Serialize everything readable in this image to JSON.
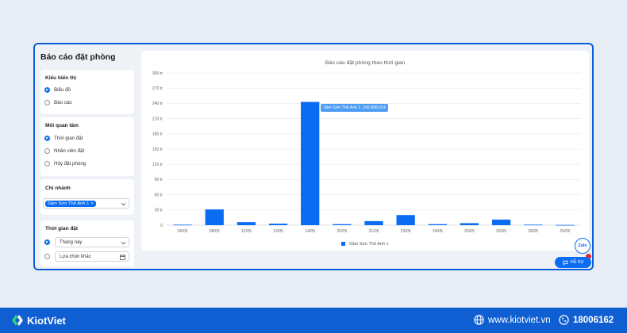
{
  "page_title": "Báo cáo đặt phòng",
  "display_type": {
    "title": "Kiểu hiển thị",
    "options": [
      {
        "label": "Biểu đồ",
        "selected": true
      },
      {
        "label": "Báo cáo",
        "selected": false
      }
    ]
  },
  "concern": {
    "title": "Mối quan tâm",
    "options": [
      {
        "label": "Thời gian đặt",
        "selected": true
      },
      {
        "label": "Nhân viên đặt",
        "selected": false
      },
      {
        "label": "Hủy đặt phòng",
        "selected": false
      }
    ]
  },
  "branch": {
    "title": "Chi nhánh",
    "selected_tag": "Sầm Sơn Thế Anh 1",
    "remove_glyph": "×"
  },
  "booking_time": {
    "title": "Thời gian đặt",
    "options": [
      {
        "label": "Tháng này",
        "selected": true,
        "control": "select"
      },
      {
        "label": "Lựa chọn khác",
        "selected": false,
        "control": "date"
      }
    ]
  },
  "support_button": {
    "label": "Hỗ trợ",
    "icon": "chat-bubble-icon"
  },
  "zalo_button": {
    "label": "Zalo"
  },
  "footer": {
    "brand": "KiotViet",
    "website": "www.kiotviet.vn",
    "hotline": "18006162",
    "accent": "#0f5fd3"
  },
  "chart_data": {
    "type": "bar",
    "title": "Báo cáo đặt phòng theo thời gian",
    "categories": [
      "06/05",
      "08/05",
      "12/05",
      "13/05",
      "14/05",
      "20/05",
      "21/05",
      "23/05",
      "24/05",
      "25/05",
      "26/05",
      "28/05",
      "29/05"
    ],
    "series": [
      {
        "name": "Sầm Sơn Thế Anh 1",
        "values": [
          1,
          31,
          6,
          3,
          242.898014,
          2,
          8,
          20,
          2,
          4,
          11,
          1,
          0.5
        ]
      }
    ],
    "y_ticks": [
      "0",
      "30 tr",
      "60 tr",
      "90 tr",
      "120 tr",
      "150 tr",
      "180 tr",
      "210 tr",
      "240 tr",
      "270 tr",
      "300 tr"
    ],
    "ylim": [
      0,
      300
    ],
    "grid": true,
    "legend_position": "bottom",
    "bar_color": "#0a6cf0",
    "tooltip": {
      "text": "Sầm Sơn Thế Anh 1: 242.898.014",
      "category_index": 4
    }
  }
}
